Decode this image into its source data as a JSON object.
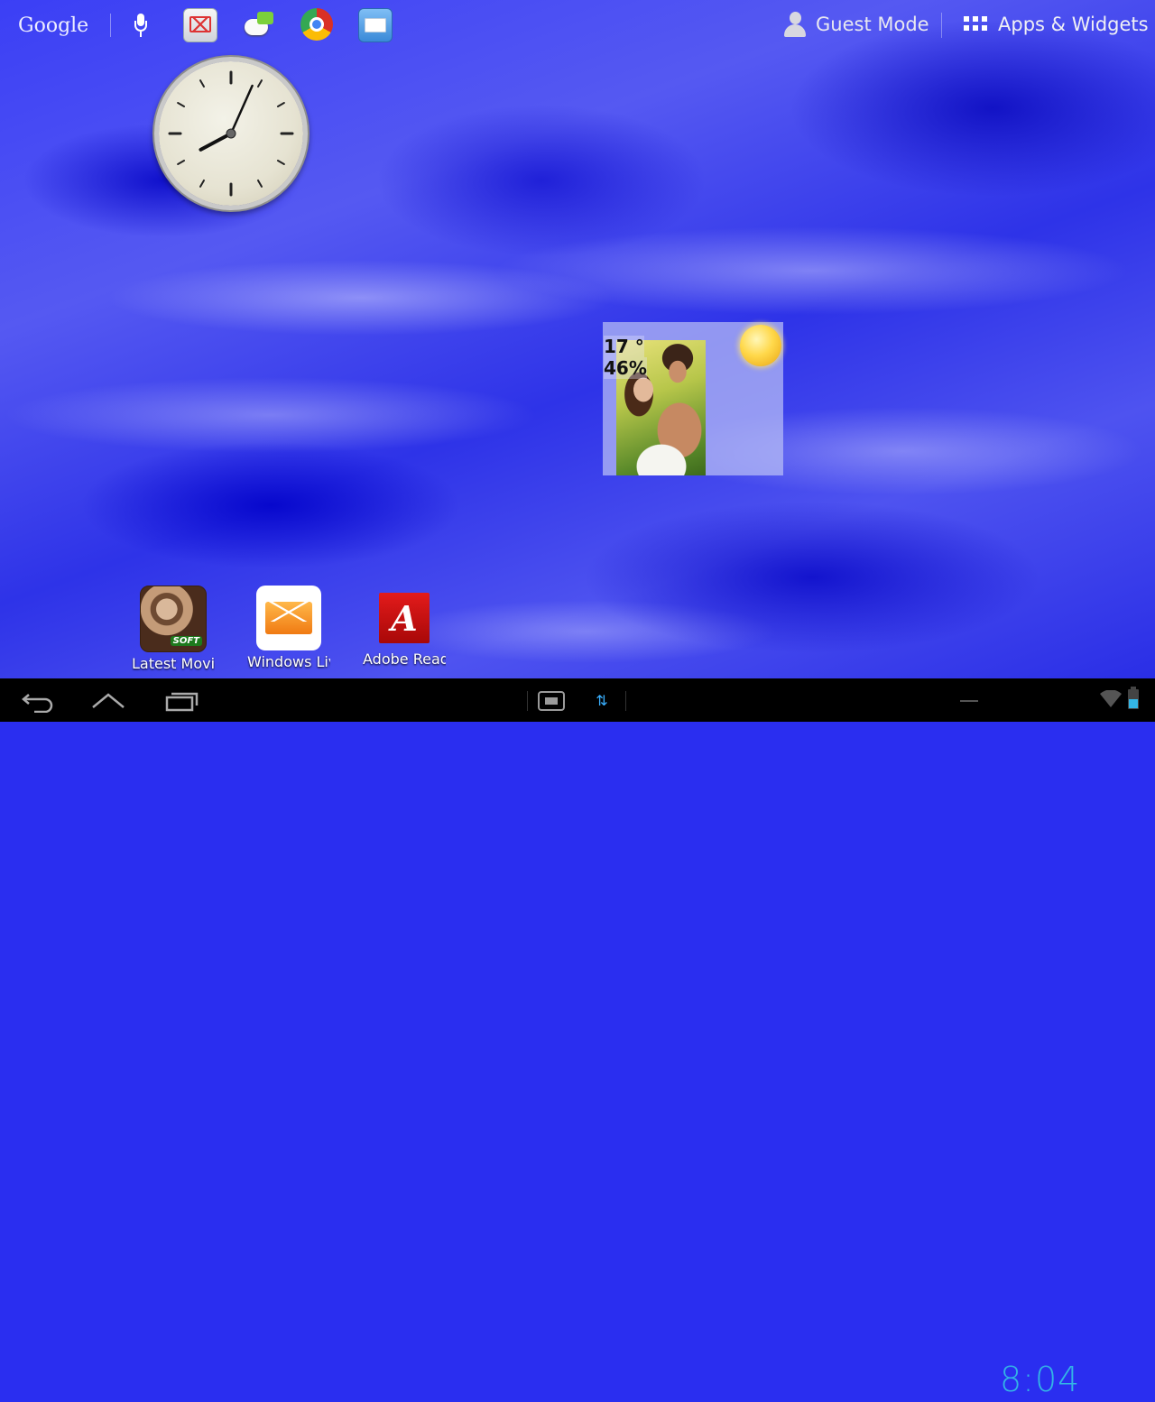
{
  "topbar": {
    "search_logo": "Google",
    "mic_icon": "mic-icon",
    "quick_apps": [
      "gmail-icon",
      "messaging-icon",
      "chrome-icon",
      "email-icon"
    ],
    "guest_mode_label": "Guest Mode",
    "apps_widgets_label": "Apps & Widgets"
  },
  "clock": {
    "hour": 8,
    "minute": 4
  },
  "weather": {
    "temperature": "17 °",
    "humidity": "46%",
    "condition_icon": "sun-icon"
  },
  "shortcuts": [
    {
      "label": "Latest Movie",
      "icon": "movie-icon"
    },
    {
      "label": "Windows Live",
      "icon": "windows-live-mail-icon"
    },
    {
      "label": "Adobe Reader",
      "icon": "adobe-reader-icon"
    }
  ],
  "systembar": {
    "time": "8:04",
    "accent_color": "#33b5e5"
  }
}
